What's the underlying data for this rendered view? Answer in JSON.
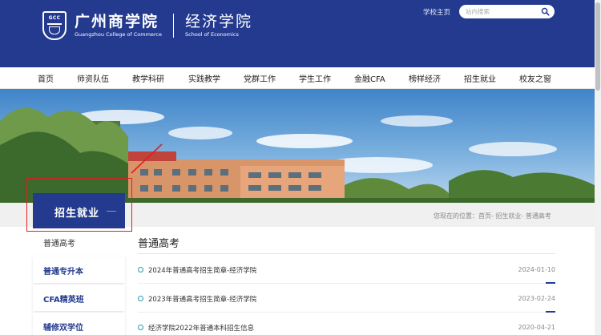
{
  "header": {
    "school_cn": "广州商学院",
    "school_en": "Guangzhou College of Commerce",
    "dept_cn": "经济学院",
    "dept_en": "School of Economics",
    "logo_text": "GCC",
    "home_link": "学校主页",
    "search_placeholder": "站内搜索"
  },
  "nav": {
    "items": [
      "首页",
      "师资队伍",
      "教学科研",
      "实践教学",
      "党群工作",
      "学生工作",
      "金融CFA",
      "榜样经济",
      "招生就业",
      "校友之窗"
    ]
  },
  "section": {
    "title": "招生就业"
  },
  "breadcrumb": {
    "prefix": "您现在的位置：",
    "path": "首页- 招生就业- 普通高考"
  },
  "sidebar": {
    "items": [
      "普通高考",
      "普通专升本",
      "CFA精英班",
      "辅修双学位"
    ]
  },
  "main": {
    "title": "普通高考",
    "news": [
      {
        "title": "2024年普通高考招生简章-经济学院",
        "date": "2024-01-10"
      },
      {
        "title": "2023年普通高考招生简章-经济学院",
        "date": "2023-02-24"
      },
      {
        "title": "经济学院2022年普通本科招生信息",
        "date": "2020-04-21"
      }
    ]
  },
  "colors": {
    "brand_blue": "#233a8f",
    "highlight_red": "#e01f1f",
    "bullet_teal": "#2a9bb0"
  }
}
